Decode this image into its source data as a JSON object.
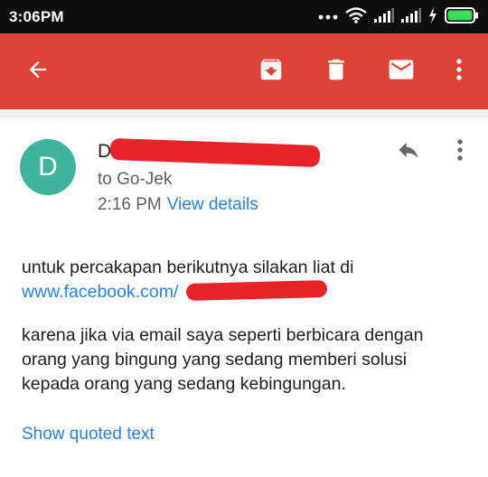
{
  "status_bar": {
    "time": "3:06PM",
    "icons": [
      "dots-icon",
      "wifi-icon",
      "signal-icon",
      "signal-icon",
      "charging-icon",
      "battery-icon"
    ]
  },
  "toolbar": {
    "color": "#db4437",
    "icons": [
      "back-arrow-icon",
      "archive-icon",
      "trash-icon",
      "mail-icon",
      "more-vert-icon"
    ]
  },
  "message": {
    "avatar_letter": "D",
    "avatar_color": "#3fb39b",
    "sender_visible": "D",
    "recipient": "to Go-Jek",
    "time": "2:16 PM",
    "view_details_label": "View details",
    "paragraph1_line1": "untuk percakapan berikutnya silakan liat di",
    "paragraph1_link": "www.facebook.com/",
    "paragraph2_lines": [
      "karena jika via email saya seperti berbicara dengan",
      "orang yang bingung yang sedang memberi solusi",
      "kepada orang yang sedang kebingungan."
    ],
    "show_quoted_label": "Show quoted text",
    "link_color": "#2f7fdc",
    "redaction_color": "#e8232a"
  }
}
